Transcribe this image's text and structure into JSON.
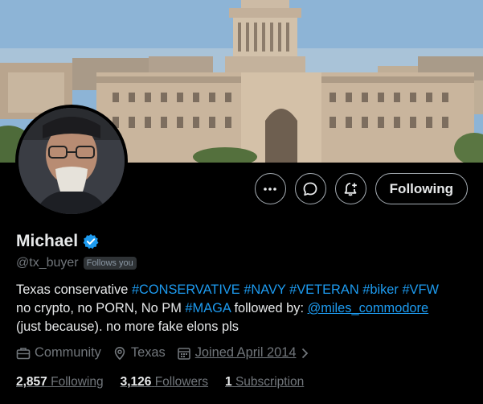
{
  "profile": {
    "name": "Michael",
    "handle": "@tx_buyer",
    "follows_you": "Follows you",
    "following_label": "Following"
  },
  "bio": {
    "line1_text": "Texas conservative ",
    "tags1": [
      "#CONSERVATIVE",
      "#NAVY",
      "#VETERAN",
      "#biker",
      "#VFW"
    ],
    "line2_text": "no crypto, no PORN, No PM ",
    "tag2": "#MAGA",
    "line2_mid": " followed by: ",
    "mention": "@miles_commodore",
    "line3": "(just because). no more fake elons pls"
  },
  "meta": {
    "category": "Community",
    "location": "Texas",
    "joined": "Joined April 2014"
  },
  "stats": {
    "following_count": "2,857",
    "following_label": "Following",
    "followers_count": "3,126",
    "followers_label": "Followers",
    "subscription_count": "1",
    "subscription_label": "Subscription"
  },
  "icons": [
    "more-icon",
    "message-icon",
    "notification-bell-icon",
    "briefcase-icon",
    "location-pin-icon",
    "calendar-icon",
    "chevron-right-icon",
    "verified-badge-icon"
  ],
  "colors": {
    "accent": "#1d9bf0",
    "background": "#000000",
    "muted": "#71767b",
    "verified": "#1d9bf0"
  }
}
